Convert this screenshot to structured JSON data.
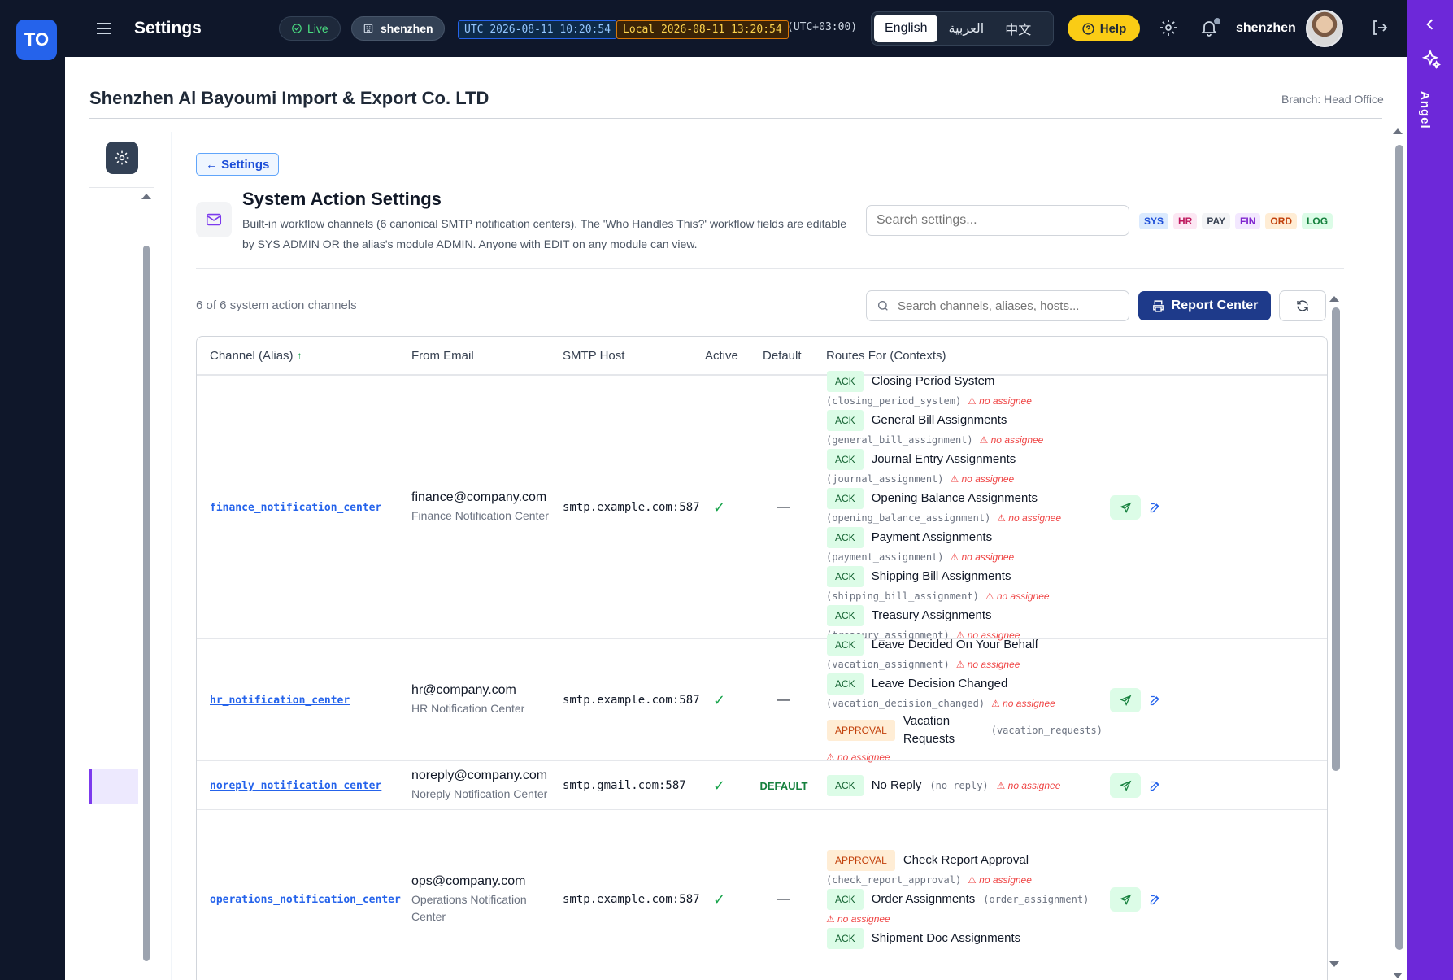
{
  "app": {
    "logo": "TO",
    "page_title": "Settings",
    "live_label": "Live",
    "org": "shenzhen",
    "utc_label": "UTC",
    "utc_time": "2026-08-11 10:20:54",
    "local_label": "Local",
    "local_time": "2026-08-11 13:20:54",
    "tz_offset": "(UTC+03:00)",
    "languages": [
      "English",
      "العربية",
      "中文"
    ],
    "active_language": "English",
    "help_label": "Help",
    "username": "shenzhen",
    "assistant_label": "Angel"
  },
  "company": {
    "name": "Shenzhen Al Bayoumi Import & Export Co. LTD",
    "branch": "Branch: Head Office"
  },
  "section": {
    "back_label": "← Settings",
    "title": "System Action Settings",
    "description": "Built-in workflow channels (6 canonical SMTP notification centers). The 'Who Handles This?' workflow fields are editable by SYS ADMIN OR the alias's module ADMIN. Anyone with EDIT on any module can view.",
    "search_placeholder": "Search settings...",
    "tags": [
      {
        "label": "SYS",
        "bg": "#dbeafe",
        "fg": "#1d4ed8"
      },
      {
        "label": "HR",
        "bg": "#fce7f3",
        "fg": "#be185d"
      },
      {
        "label": "PAY",
        "bg": "#f3f4f6",
        "fg": "#374151"
      },
      {
        "label": "FIN",
        "bg": "#f3e8ff",
        "fg": "#7e22ce"
      },
      {
        "label": "ORD",
        "bg": "#ffedd5",
        "fg": "#c2410c"
      },
      {
        "label": "LOG",
        "bg": "#dcfce7",
        "fg": "#15803d"
      }
    ],
    "count_text": "6 of 6 system action channels",
    "channel_search_placeholder": "Search channels, aliases, hosts...",
    "report_center_label": "Report Center"
  },
  "table": {
    "headers": {
      "alias": "Channel (Alias)",
      "sort_indicator": "↑",
      "from": "From Email",
      "smtp": "SMTP Host",
      "active": "Active",
      "default": "Default",
      "routes": "Routes For (Contexts)"
    },
    "no_assignee": "⚠ no assignee",
    "check_glyph": "✓",
    "dash_glyph": "—",
    "default_label": "DEFAULT",
    "rows": [
      {
        "alias": "finance_notification_center",
        "email": "finance@company.com",
        "sender": "Finance Notification Center",
        "smtp": "smtp.example.com:587",
        "is_default": false,
        "routes": [
          {
            "badge": "ACK",
            "label": "Closing Period System",
            "ctx": "(closing_period_system)"
          },
          {
            "badge": "ACK",
            "label": "General Bill Assignments",
            "ctx": "(general_bill_assignment)"
          },
          {
            "badge": "ACK",
            "label": "Journal Entry Assignments",
            "ctx": "(journal_assignment)"
          },
          {
            "badge": "ACK",
            "label": "Opening Balance Assignments",
            "ctx": "(opening_balance_assignment)"
          },
          {
            "badge": "ACK",
            "label": "Payment Assignments",
            "ctx": "(payment_assignment)"
          },
          {
            "badge": "ACK",
            "label": "Shipping Bill Assignments",
            "ctx": "(shipping_bill_assignment)"
          },
          {
            "badge": "ACK",
            "label": "Treasury Assignments",
            "ctx": "(treasury_assignment)"
          }
        ]
      },
      {
        "alias": "hr_notification_center",
        "email": "hr@company.com",
        "sender": "HR Notification Center",
        "smtp": "smtp.example.com:587",
        "is_default": false,
        "routes": [
          {
            "badge": "ACK",
            "label": "Leave Decided On Your Behalf",
            "ctx": "(vacation_assignment)"
          },
          {
            "badge": "ACK",
            "label": "Leave Decision Changed",
            "ctx": "(vacation_decision_changed)"
          },
          {
            "badge": "APPROVAL",
            "label": "Vacation Requests",
            "ctx": "(vacation_requests)"
          }
        ]
      },
      {
        "alias": "noreply_notification_center",
        "email": "noreply@company.com",
        "sender": "Noreply Notification Center",
        "smtp": "smtp.gmail.com:587",
        "is_default": true,
        "routes": [
          {
            "badge": "ACK",
            "label": "No Reply",
            "ctx": "(no_reply)"
          }
        ]
      },
      {
        "alias": "operations_notification_center",
        "email": "ops@company.com",
        "sender": "Operations Notification Center",
        "smtp": "smtp.example.com:587",
        "is_default": false,
        "routes": [
          {
            "badge": "APPROVAL",
            "label": "Check Report Approval",
            "ctx": "(check_report_approval)"
          },
          {
            "badge": "ACK",
            "label": "Order Assignments",
            "ctx": "(order_assignment)"
          },
          {
            "badge": "ACK",
            "label": "Shipment Doc Assignments",
            "ctx": ""
          }
        ]
      }
    ]
  }
}
